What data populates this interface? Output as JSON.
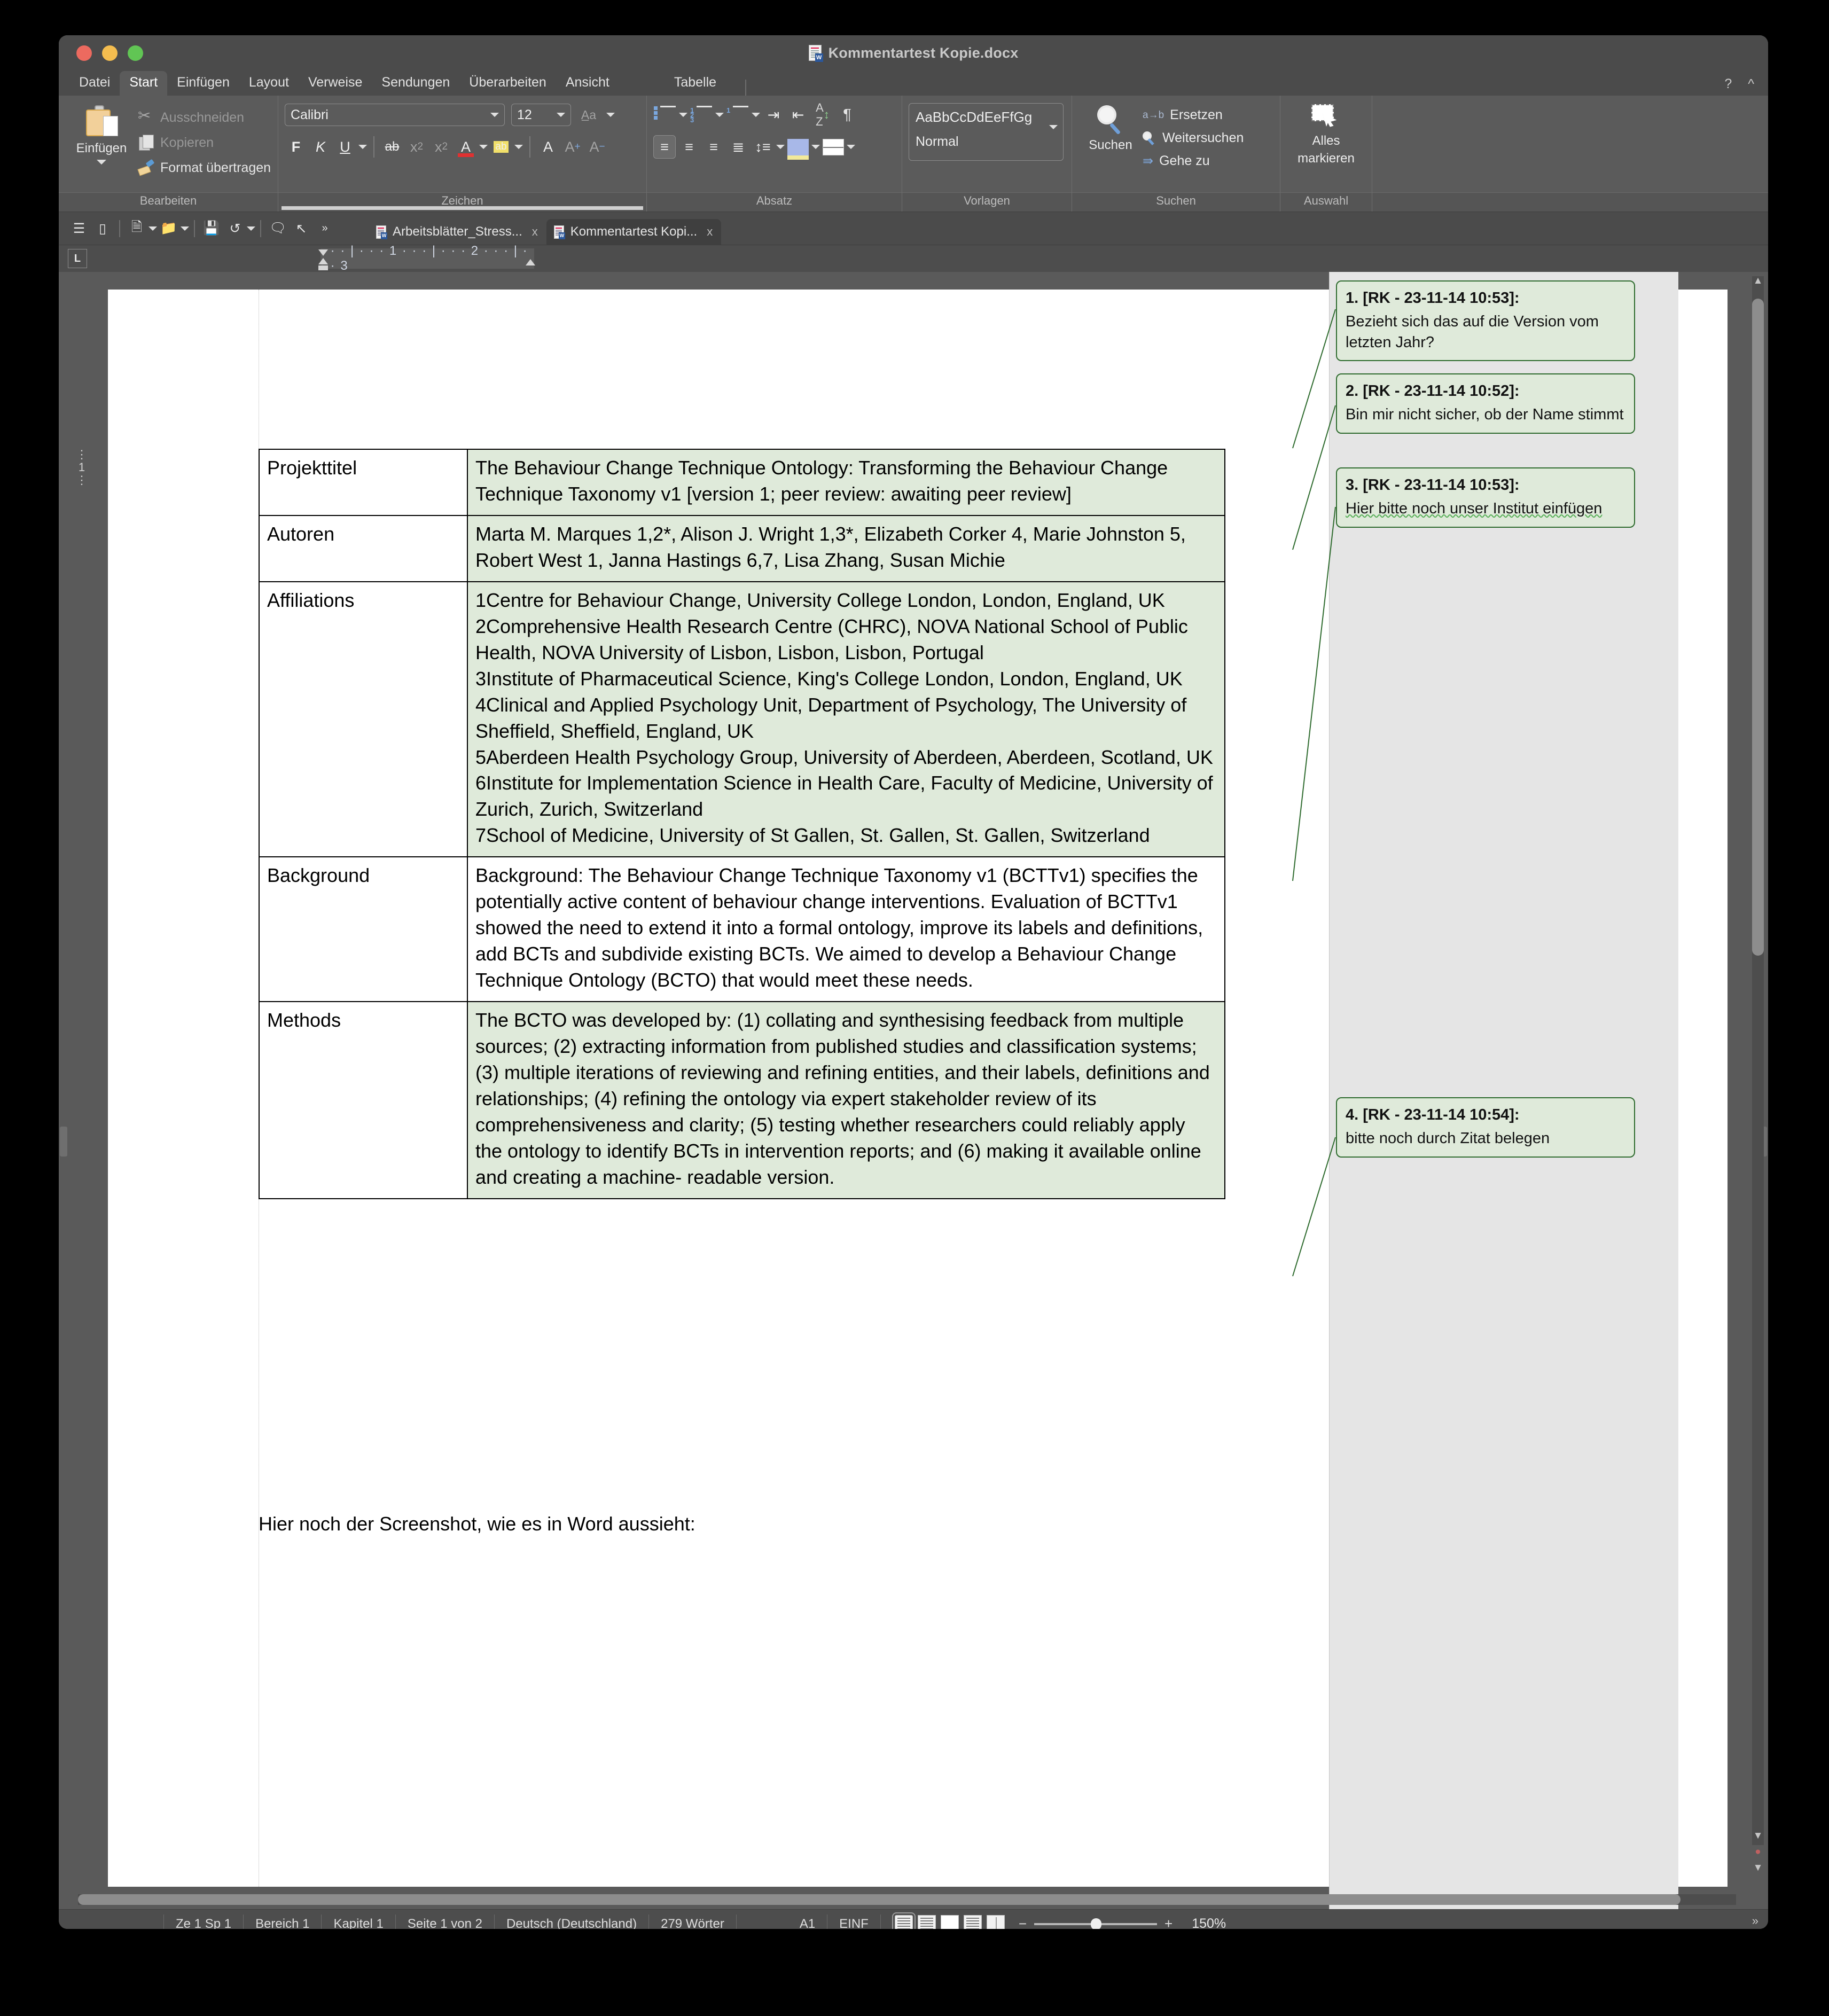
{
  "window": {
    "title": "Kommentartest Kopie.docx"
  },
  "menu": {
    "items": [
      "Datei",
      "Start",
      "Einfügen",
      "Layout",
      "Verweise",
      "Sendungen",
      "Überarbeiten",
      "Ansicht"
    ],
    "active": "Start",
    "context_tab": "Tabelle",
    "help": "?",
    "collapse": "^"
  },
  "ribbon": {
    "groups": [
      {
        "label": "Bearbeiten",
        "paste_label": "Einfügen",
        "items": [
          "Ausschneiden",
          "Kopieren",
          "Format übertragen"
        ]
      },
      {
        "label": "Zeichen",
        "font_name": "Calibri",
        "font_size": "12",
        "bold": "F",
        "italic": "K",
        "underline": "U",
        "strike": "ab",
        "subscript": "x",
        "superscript": "x",
        "font_color": "A",
        "highlight": "ab",
        "clear_format": "A",
        "grow_font": "A",
        "shrink_font": "A"
      },
      {
        "label": "Absatz"
      },
      {
        "label": "Vorlagen",
        "style_preview": "AaBbCcDdEeFfGg",
        "style_name": "Normal"
      },
      {
        "label": "Suchen",
        "search_label": "Suchen",
        "replace_label": "Ersetzen",
        "find_next_label": "Weitersuchen",
        "goto_label": "Gehe zu"
      },
      {
        "label": "Auswahl",
        "select_all_line1": "Alles",
        "select_all_line2": "markieren"
      }
    ]
  },
  "doctabs": [
    {
      "label": "Arbeitsblätter_Stress...",
      "close": "x",
      "active": false
    },
    {
      "label": "Kommentartest Kopi...",
      "close": "x",
      "active": true
    }
  ],
  "ruler": {
    "tab_marker": "L",
    "ticks": "· · · | · · ·  1  · · · | · · ·  2  · · · | · · ·  3"
  },
  "document": {
    "table": [
      {
        "label": "Projekttitel",
        "value": "The Behaviour Change Technique Ontology: Transforming the Behaviour Change Technique Taxonomy v1 [version 1; peer review: awaiting peer review]"
      },
      {
        "label": "Autoren",
        "value": "Marta M. Marques   1,2*, Alison J. Wright   1,3*, Elizabeth Corker   4, Marie Johnston 5, Robert West   1, Janna Hastings   6,7, Lisa Zhang, Susan Michie"
      },
      {
        "label": "Affiliations",
        "value_lines": [
          "1Centre for Behaviour Change, University College London, London, England, UK",
          "2Comprehensive Health Research Centre (CHRC), NOVA National School of Public Health, NOVA University of Lisbon, Lisbon, Lisbon, Portugal",
          "3Institute of Pharmaceutical Science, King's College London, London, England, UK",
          "4Clinical and Applied Psychology Unit, Department of Psychology, The University of Sheffield, Sheffield, England, UK",
          "5Aberdeen Health Psychology Group, University of Aberdeen, Aberdeen, Scotland, UK",
          "6Institute for Implementation Science in Health Care, Faculty of Medicine, University of Zurich, Zurich, Switzerland",
          "7School of Medicine, University of St Gallen, St. Gallen, St. Gallen, Switzerland"
        ]
      },
      {
        "label": "Background",
        "value": "Background: The Behaviour Change Technique Taxonomy v1 (BCTTv1) specifies the potentially active content of behaviour change interventions. Evaluation of BCTTv1 showed the need to extend it into a formal ontology, improve its labels and definitions, add BCTs and subdivide existing BCTs. We aimed to develop a Behaviour Change Technique Ontology (BCTO) that would meet these needs."
      },
      {
        "label": "Methods",
        "value": "The BCTO was developed by: (1) collating and synthesising feedback from multiple sources; (2) extracting information from published studies and classification systems; (3) multiple iterations of reviewing and refining entities, and their labels, definitions and relationships; (4) refining the ontology via expert stakeholder review of its comprehensiveness and clarity; (5) testing whether researchers could reliably apply the ontology to identify BCTs in intervention reports; and (6) making it available online and creating a machine- readable version."
      }
    ],
    "trailing_text": "Hier noch der Screenshot, wie es in Word aussieht:"
  },
  "comments": [
    {
      "header": "1. [RK - 23-11-14 10:53]:",
      "body": "Bezieht sich das auf die Version vom letzten Jahr?"
    },
    {
      "header": "2. [RK - 23-11-14 10:52]:",
      "body": "Bin mir nicht sicher, ob der Name stimmt"
    },
    {
      "header": "3. [RK - 23-11-14 10:53]:",
      "body": "Hier bitte noch unser Institut einfügen"
    },
    {
      "header": "4. [RK - 23-11-14 10:54]:",
      "body": "bitte noch durch Zitat belegen"
    }
  ],
  "statusbar": {
    "position": "Ze 1 Sp 1",
    "section": "Bereich 1",
    "chapter": "Kapitel 1",
    "page": "Seite 1 von 2",
    "language": "Deutsch (Deutschland)",
    "words": "279 Wörter",
    "cell": "A1",
    "insert_mode": "EINF",
    "zoom": "150%",
    "zoom_out": "−",
    "zoom_in": "+",
    "overflow": "»"
  },
  "colors": {
    "comment_fill": "#dfeada",
    "comment_border": "#2e6b2e",
    "table_fill": "#dfeada",
    "chrome": "#4d4d4d",
    "ribbon": "#5b5b5b"
  }
}
